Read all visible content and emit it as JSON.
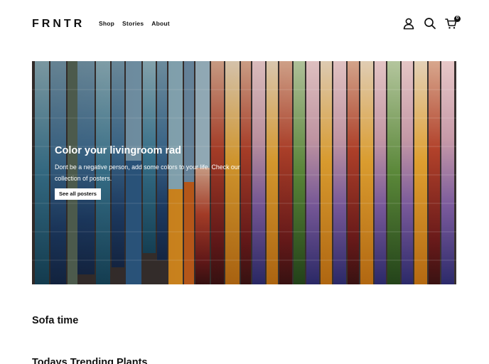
{
  "header": {
    "logo": "FRNTR",
    "nav": [
      {
        "label": "Shop"
      },
      {
        "label": "Stories"
      },
      {
        "label": "About"
      }
    ],
    "icons": [
      "account-icon",
      "search-icon",
      "cart-icon"
    ],
    "cart_count": "0"
  },
  "hero": {
    "title": "Color your livingroom rad",
    "text": "Dont be a negative person, add some colors to your life. Check our collection of posters.",
    "button_label": "See all posters"
  },
  "sections": [
    {
      "title": "Sofa time"
    },
    {
      "title": "Todays Trending Plants"
    }
  ],
  "colors": {
    "text": "#111111",
    "background": "#ffffff",
    "button_bg": "#ffffff"
  }
}
